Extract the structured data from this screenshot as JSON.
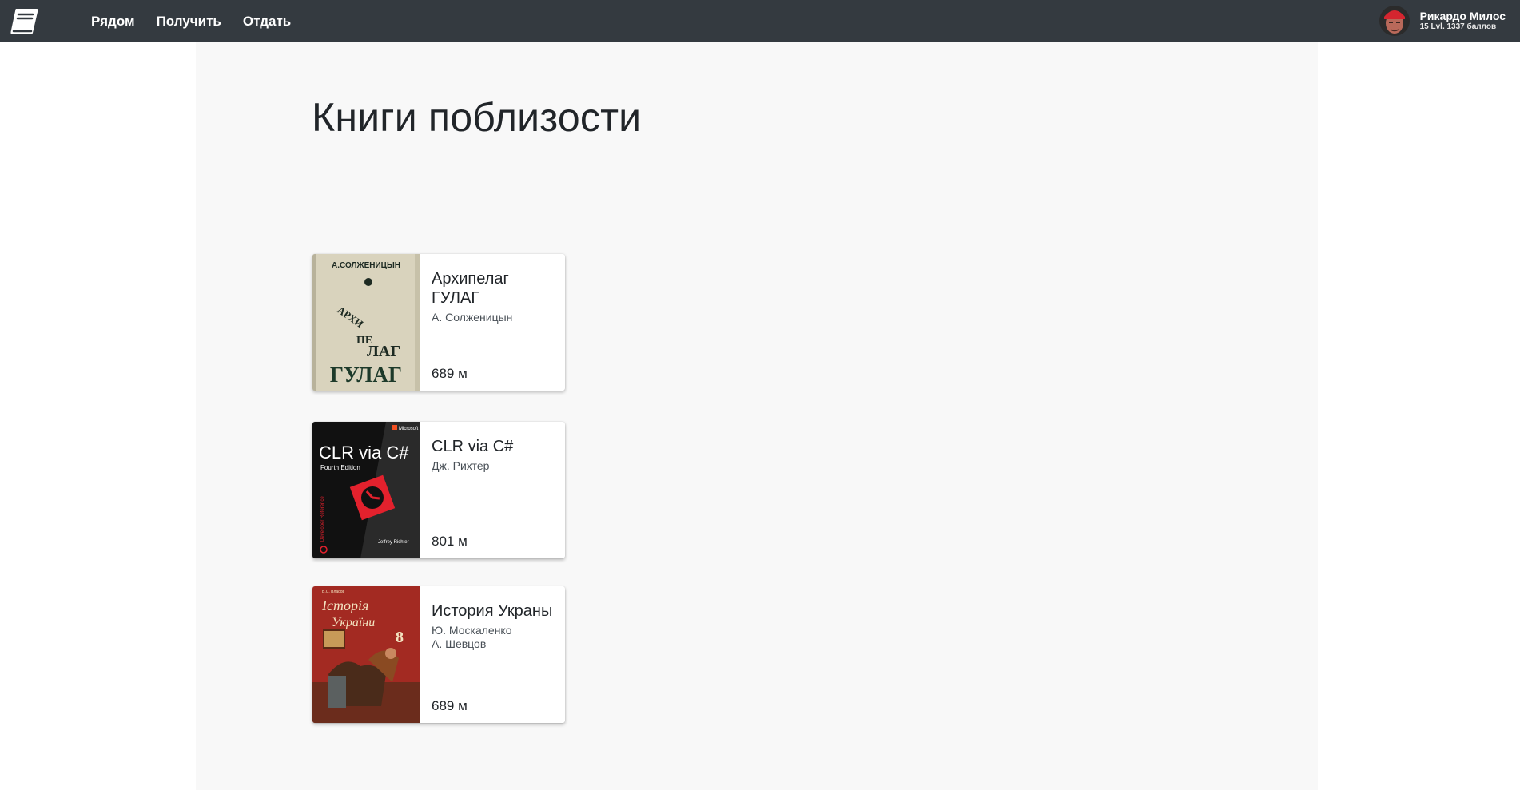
{
  "nav": {
    "items": [
      "Рядом",
      "Получить",
      "Отдать"
    ]
  },
  "user": {
    "name": "Рикардо Милос",
    "stats": "15 Lvl. 1337 баллов"
  },
  "page": {
    "title": "Книги поблизости"
  },
  "books": [
    {
      "title": "Архипелаг ГУЛАГ",
      "authors": [
        "А. Солженицын"
      ],
      "distance": "689 м",
      "cover_text": [
        "А.СОЛЖЕНИЦЫН",
        "АРХИ",
        "ПЕ",
        "ЛАГ",
        "ГУЛАГ"
      ]
    },
    {
      "title": "CLR via C#",
      "authors": [
        "Дж. Рихтер"
      ],
      "distance": "801 м",
      "cover_text": [
        "Microsoft",
        "CLR via C#",
        "Fourth Edition",
        "Developer Reference",
        "Jeffrey Richter"
      ]
    },
    {
      "title": "История Украны",
      "authors": [
        "Ю. Москаленко",
        "А. Шевцов"
      ],
      "distance": "689 м",
      "cover_text": [
        "В.С. Власов",
        "Історія",
        "України",
        "8"
      ]
    }
  ],
  "colors": {
    "topbar": "#343a40",
    "content_bg": "#f8f8f8",
    "card_bg": "#ffffff",
    "clr_accent": "#e3212d",
    "ukraine_cover": "#a32a22",
    "gulag_cover": "#d9d3bd"
  }
}
